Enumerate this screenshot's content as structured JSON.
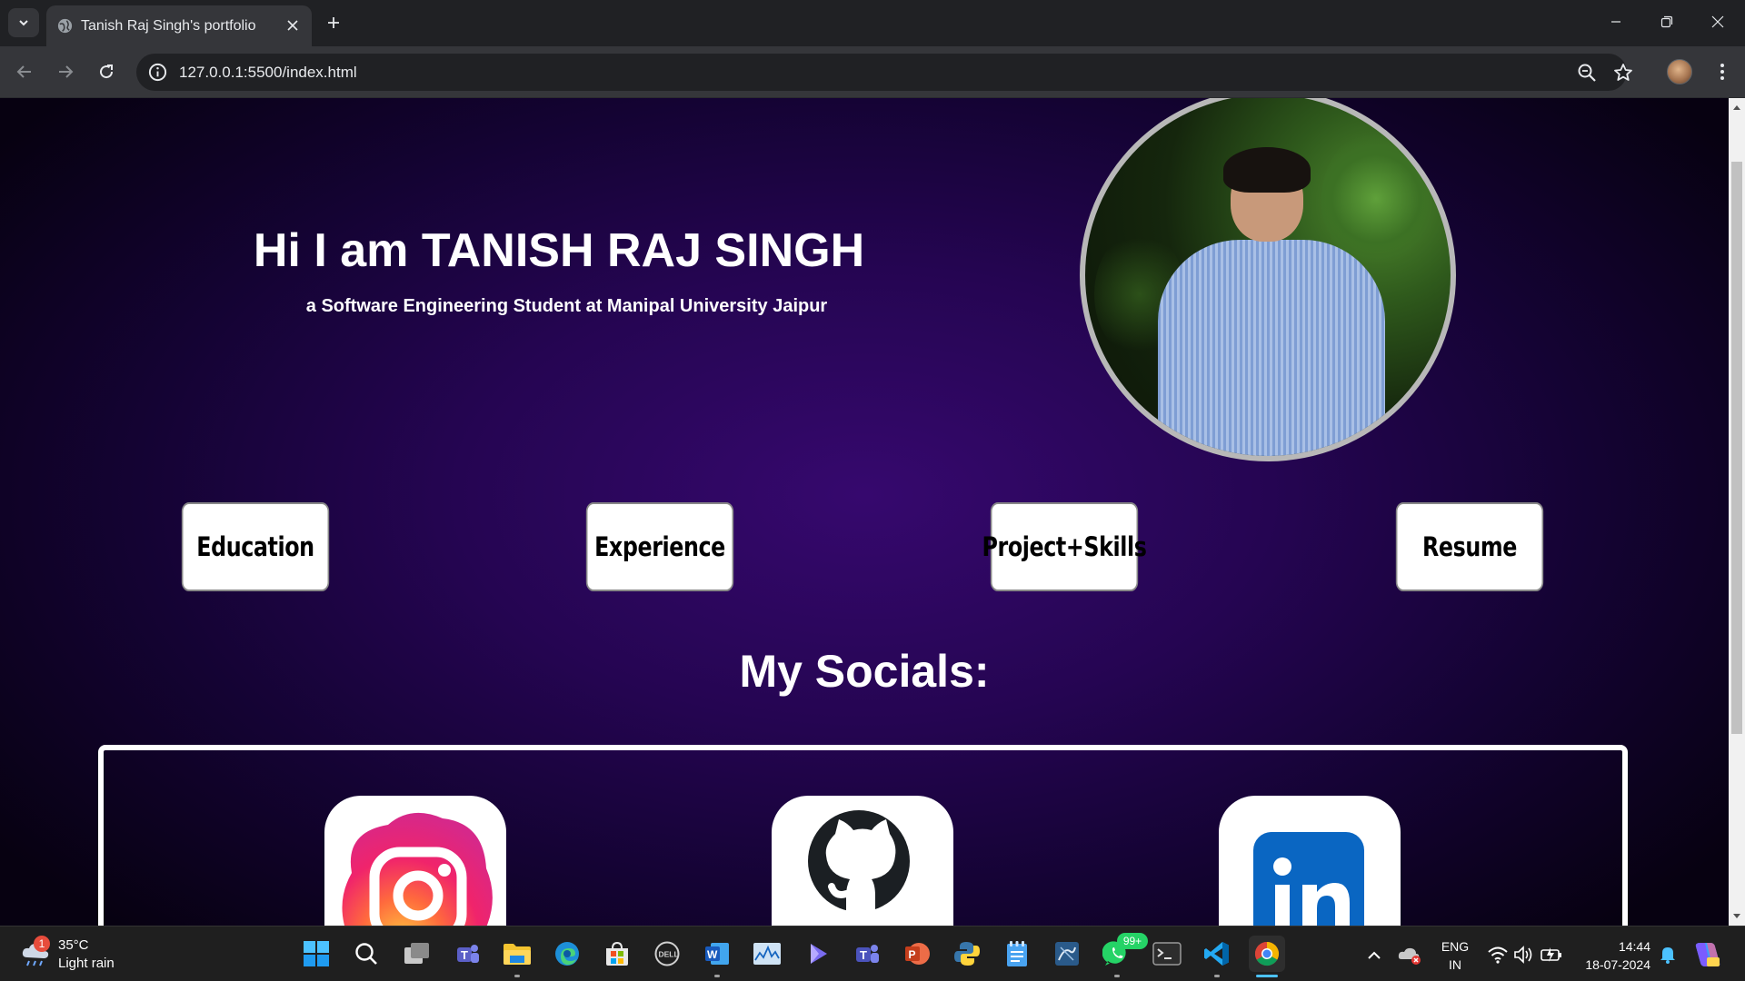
{
  "browser": {
    "tab": {
      "title": "Tanish Raj Singh's portfolio"
    },
    "address_bar": {
      "url": "127.0.0.1:5500/index.html"
    }
  },
  "page": {
    "hero": {
      "title": "Hi I am TANISH RAJ SINGH",
      "subtitle": "a Software Engineering Student at Manipal University Jaipur"
    },
    "nav_cards": [
      {
        "label": "Education"
      },
      {
        "label": "Experience"
      },
      {
        "label": "Project+Skills"
      },
      {
        "label": "Resume"
      }
    ],
    "socials": {
      "heading": "My Socials:",
      "items": [
        {
          "icon": "instagram-icon"
        },
        {
          "icon": "github-icon"
        },
        {
          "icon": "linkedin-icon"
        }
      ]
    },
    "colors": {
      "page_bg_center": "#36086e",
      "page_bg_edge": "#070111",
      "card_bg": "#ffffff",
      "linkedin_blue": "#0a66c2"
    }
  },
  "taskbar": {
    "weather": {
      "temp": "35°C",
      "desc": "Light rain",
      "badge": "1"
    },
    "whatsapp_badge": "99+",
    "language": {
      "line1": "ENG",
      "line2": "IN"
    },
    "clock": {
      "time": "14:44",
      "date": "18-07-2024"
    }
  }
}
